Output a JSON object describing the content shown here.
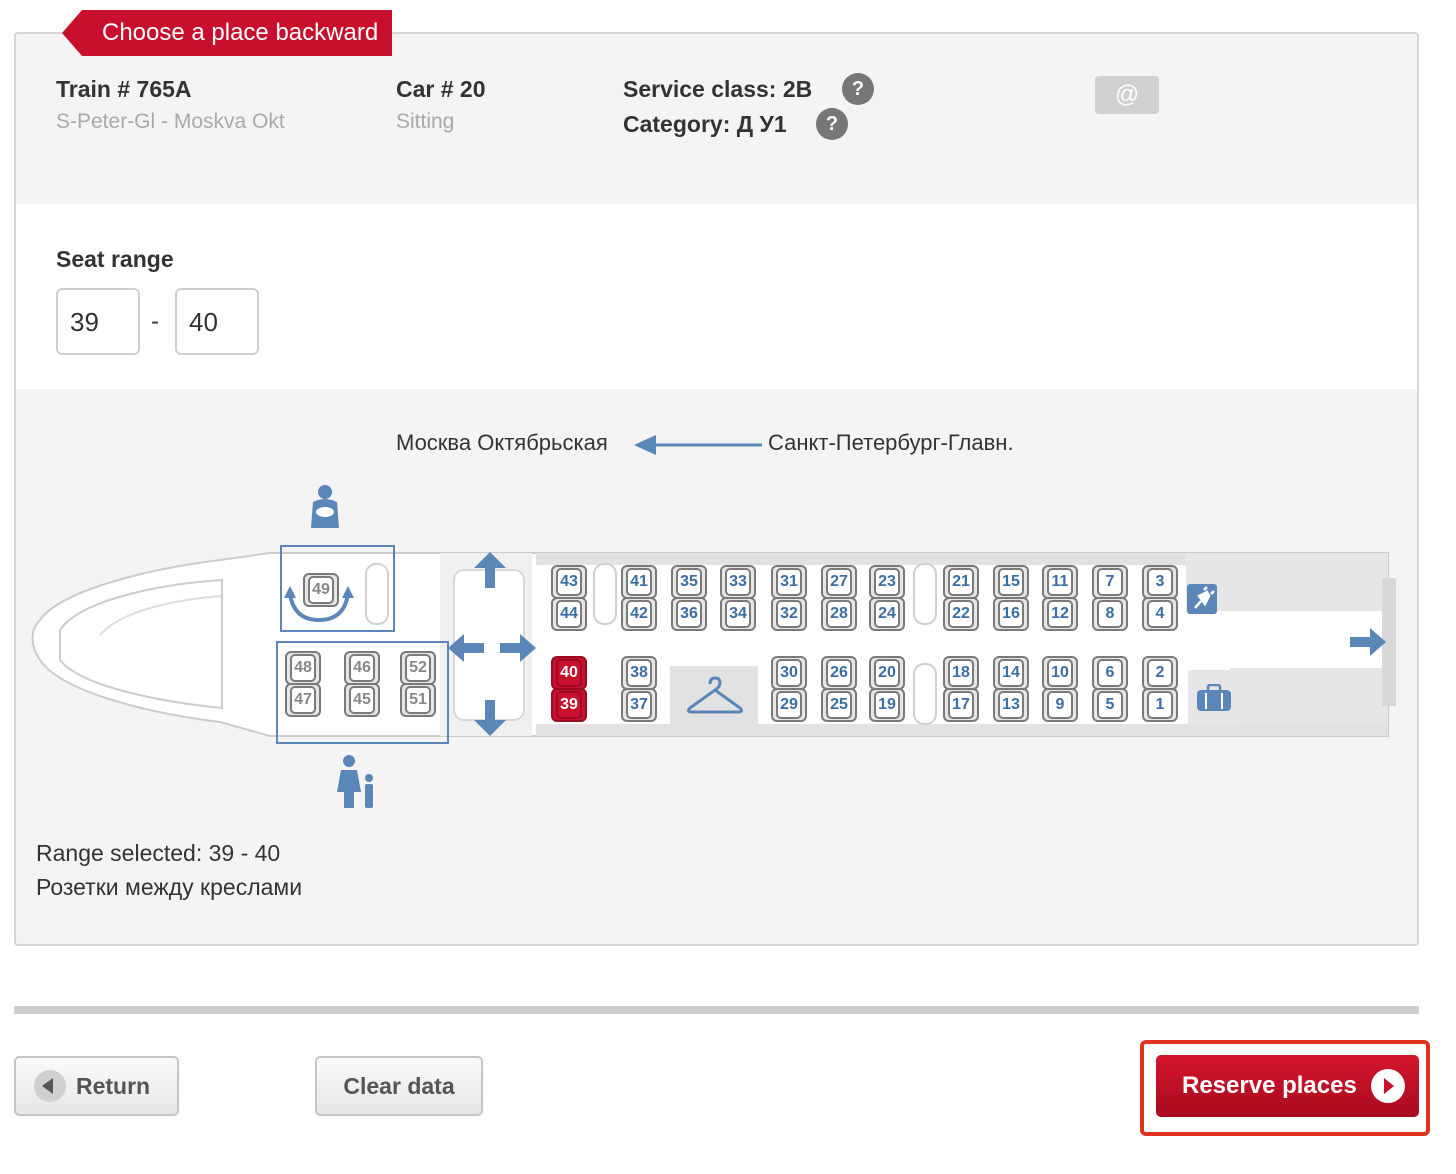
{
  "header": {
    "ribbon": "Choose a place backward",
    "train_label": "Train # 765A",
    "route": "S-Peter-Gl - Moskva Okt",
    "car_label": "Car # 20",
    "car_type": "Sitting",
    "service_class": "Service class: 2B",
    "category": "Category: Д У1",
    "help_glyph": "?",
    "ticket_glyph": "@"
  },
  "range": {
    "title": "Seat range",
    "from": "39",
    "separator": "-",
    "to": "40"
  },
  "direction": {
    "to": "Москва Октябрьская",
    "from": "Санкт-Петербург-Главн."
  },
  "seats": [
    {
      "num": "43",
      "selected": false,
      "available": true
    },
    {
      "num": "44",
      "selected": false,
      "available": true
    },
    {
      "num": "41",
      "selected": false,
      "available": true
    },
    {
      "num": "42",
      "selected": false,
      "available": true
    },
    {
      "num": "35",
      "selected": false,
      "available": true
    },
    {
      "num": "36",
      "selected": false,
      "available": true
    },
    {
      "num": "33",
      "selected": false,
      "available": true
    },
    {
      "num": "34",
      "selected": false,
      "available": true
    },
    {
      "num": "31",
      "selected": false,
      "available": true
    },
    {
      "num": "32",
      "selected": false,
      "available": true
    },
    {
      "num": "27",
      "selected": false,
      "available": true
    },
    {
      "num": "28",
      "selected": false,
      "available": true
    },
    {
      "num": "23",
      "selected": false,
      "available": true
    },
    {
      "num": "24",
      "selected": false,
      "available": true
    },
    {
      "num": "21",
      "selected": false,
      "available": true
    },
    {
      "num": "22",
      "selected": false,
      "available": true
    },
    {
      "num": "15",
      "selected": false,
      "available": true
    },
    {
      "num": "16",
      "selected": false,
      "available": true
    },
    {
      "num": "11",
      "selected": false,
      "available": true
    },
    {
      "num": "12",
      "selected": false,
      "available": true
    },
    {
      "num": "7",
      "selected": false,
      "available": true
    },
    {
      "num": "8",
      "selected": false,
      "available": true
    },
    {
      "num": "3",
      "selected": false,
      "available": true
    },
    {
      "num": "4",
      "selected": false,
      "available": true
    },
    {
      "num": "40",
      "selected": true,
      "available": true
    },
    {
      "num": "39",
      "selected": true,
      "available": true
    },
    {
      "num": "38",
      "selected": false,
      "available": true
    },
    {
      "num": "37",
      "selected": false,
      "available": true
    },
    {
      "num": "30",
      "selected": false,
      "available": true
    },
    {
      "num": "29",
      "selected": false,
      "available": true
    },
    {
      "num": "26",
      "selected": false,
      "available": true
    },
    {
      "num": "25",
      "selected": false,
      "available": true
    },
    {
      "num": "20",
      "selected": false,
      "available": true
    },
    {
      "num": "19",
      "selected": false,
      "available": true
    },
    {
      "num": "18",
      "selected": false,
      "available": true
    },
    {
      "num": "17",
      "selected": false,
      "available": true
    },
    {
      "num": "14",
      "selected": false,
      "available": true
    },
    {
      "num": "13",
      "selected": false,
      "available": true
    },
    {
      "num": "10",
      "selected": false,
      "available": true
    },
    {
      "num": "9",
      "selected": false,
      "available": true
    },
    {
      "num": "6",
      "selected": false,
      "available": true
    },
    {
      "num": "5",
      "selected": false,
      "available": true
    },
    {
      "num": "2",
      "selected": false,
      "available": true
    },
    {
      "num": "1",
      "selected": false,
      "available": true
    },
    {
      "num": "49",
      "selected": false,
      "available": false
    },
    {
      "num": "48",
      "selected": false,
      "available": false
    },
    {
      "num": "47",
      "selected": false,
      "available": false
    },
    {
      "num": "46",
      "selected": false,
      "available": false
    },
    {
      "num": "45",
      "selected": false,
      "available": false
    },
    {
      "num": "52",
      "selected": false,
      "available": false
    },
    {
      "num": "51",
      "selected": false,
      "available": false
    }
  ],
  "info": {
    "range_selected": "Range selected: 39 - 40",
    "note": "Розетки между креслами"
  },
  "buttons": {
    "return": "Return",
    "clear": "Clear data",
    "reserve": "Reserve places"
  },
  "colors": {
    "brand_red": "#c8102e",
    "map_blue": "#3b6ea5",
    "highlight_border": "#e0321c"
  }
}
